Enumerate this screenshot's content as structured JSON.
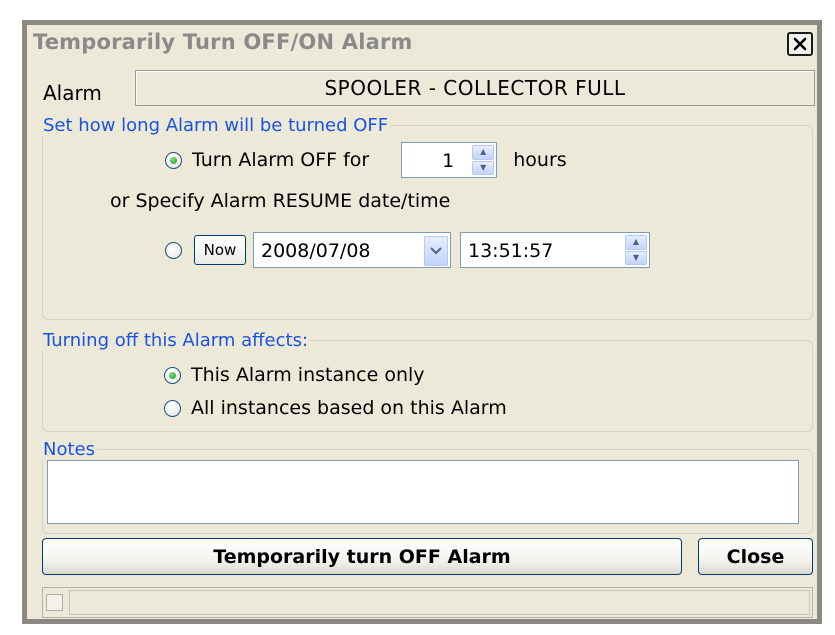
{
  "window": {
    "title": "Temporarily Turn OFF/ON Alarm",
    "close_label": "X"
  },
  "alarm": {
    "label": "Alarm",
    "value": "SPOOLER - COLLECTOR FULL"
  },
  "duration_group": {
    "legend": "Set how long Alarm will be turned OFF",
    "turn_off_for_label": "Turn Alarm OFF for",
    "hours_value": "1",
    "hours_unit": "hours",
    "or_specify_label": "or Specify Alarm RESUME date/time",
    "now_label": "Now",
    "resume_date": "2008/07/08",
    "resume_time": "13:51:57",
    "selected": "hours"
  },
  "scope_group": {
    "legend": "Turning off this Alarm affects:",
    "option_instance": "This Alarm instance only",
    "option_all": "All instances based on this Alarm",
    "selected": "instance"
  },
  "notes": {
    "legend": "Notes",
    "value": ""
  },
  "actions": {
    "primary_label": "Temporarily turn OFF Alarm",
    "close_label": "Close"
  },
  "colors": {
    "legend": "#1b52e0",
    "background": "#ece9d8",
    "title": "#8a8a8a"
  },
  "icons": {
    "close": "close-x-icon",
    "spin": "spin-updown-icon",
    "dropdown": "chevron-down-icon",
    "radio_selected": "radio-selected-icon"
  }
}
